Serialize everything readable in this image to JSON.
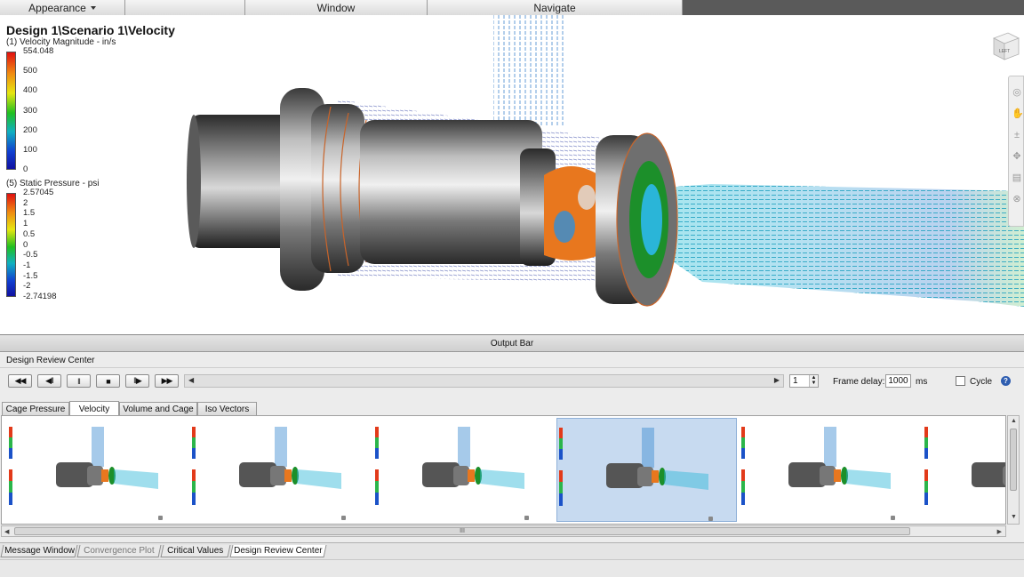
{
  "menu": {
    "appearance": "Appearance",
    "window": "Window",
    "navigate": "Navigate"
  },
  "viewport": {
    "title": "Design 1\\Scenario 1\\Velocity",
    "velocity_legend": {
      "title": "(1) Velocity Magnitude - in/s",
      "ticks": [
        "554.048",
        "500",
        "400",
        "300",
        "200",
        "100",
        "0"
      ]
    },
    "pressure_legend": {
      "title": "(5) Static Pressure - psi",
      "ticks": [
        "2.57045",
        "2",
        "1.5",
        "1",
        "0.5",
        "0",
        "-0.5",
        "-1",
        "-1.5",
        "-2",
        "-2.74198"
      ]
    },
    "viewcube_label": "LEFT"
  },
  "output_bar": {
    "label": "Output Bar"
  },
  "design_review": {
    "title": "Design Review Center",
    "buttons": [
      "◀◀",
      "◀‖",
      "‖",
      "■",
      "‖▶",
      "▶▶"
    ],
    "frame_value": "1",
    "frame_delay_label": "Frame delay:",
    "frame_delay_value": "1000",
    "frame_delay_unit": "ms",
    "cycle_label": "Cycle",
    "tabs": [
      "Cage Pressure",
      "Velocity",
      "Volume and Cage",
      "Iso Vectors"
    ],
    "active_tab": "Velocity",
    "thumbnail_count": 6,
    "selected_thumbnail": 3,
    "hscroll_grip": "III"
  },
  "bottom_tabs": [
    "Message Window",
    "Convergence Plot",
    "Critical Values",
    "Design Review Center"
  ],
  "colors": {
    "accent": "#2e5db0",
    "selection": "#c7daf0",
    "shaft": "#6b6b6b",
    "flow": "#1e90b0"
  }
}
